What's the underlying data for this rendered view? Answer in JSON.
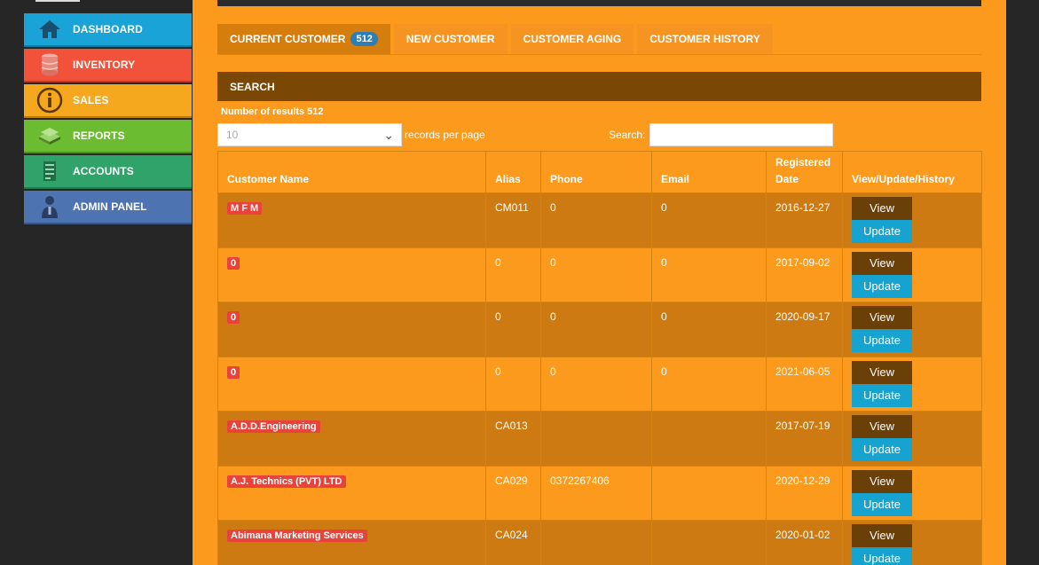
{
  "sidebar": {
    "items": [
      {
        "label": "DASHBOARD",
        "icon": "home-icon"
      },
      {
        "label": "INVENTORY",
        "icon": "database-icon"
      },
      {
        "label": "SALES",
        "icon": "info-icon"
      },
      {
        "label": "REPORTS",
        "icon": "money-stack-icon"
      },
      {
        "label": "ACCOUNTS",
        "icon": "ledger-icon"
      },
      {
        "label": "ADMIN PANEL",
        "icon": "user-admin-icon"
      }
    ]
  },
  "tabs": [
    {
      "label": "CURRENT CUSTOMER",
      "badge": "512",
      "active": true
    },
    {
      "label": "NEW CUSTOMER"
    },
    {
      "label": "CUSTOMER AGING"
    },
    {
      "label": "CUSTOMER HISTORY"
    }
  ],
  "search_panel": {
    "title": "SEARCH",
    "results_text": "Number of results 512",
    "per_page_value": "10",
    "per_page_label": "records per page",
    "search_label": "Search:",
    "search_value": ""
  },
  "table": {
    "headers": [
      "Customer Name",
      "Alias",
      "Phone",
      "Email",
      "Registered Date",
      "View/Update/History"
    ],
    "header_registered_line1": "Registered",
    "header_registered_line2": "Date",
    "view_label": "View",
    "update_label": "Update",
    "rows": [
      {
        "name": "M F M",
        "alias": "CM011",
        "phone": "0",
        "email": "0",
        "date": "2016-12-27"
      },
      {
        "name": "0",
        "alias": "0",
        "phone": "0",
        "email": "0",
        "date": "2017-09-02"
      },
      {
        "name": "0",
        "alias": "0",
        "phone": "0",
        "email": "0",
        "date": "2020-09-17"
      },
      {
        "name": "0",
        "alias": "0",
        "phone": "0",
        "email": "0",
        "date": "2021-06-05"
      },
      {
        "name": "A.D.D.Engineering",
        "alias": "CA013",
        "phone": "",
        "email": "",
        "date": "2017-07-19"
      },
      {
        "name": "A.J. Technics (PVT) LTD",
        "alias": "CA029",
        "phone": "0372267406",
        "email": "",
        "date": "2020-12-29"
      },
      {
        "name": "Abimana Marketing Services",
        "alias": "CA024",
        "phone": "",
        "email": "",
        "date": "2020-01-02"
      }
    ]
  },
  "colors": {
    "main_bg": "#fb9a1c",
    "row_dark": "#cd7a12",
    "header_dark": "#7a4704",
    "badge_red": "#e8433a",
    "update_blue": "#17a3cf",
    "view_brown": "#6b3f08"
  }
}
